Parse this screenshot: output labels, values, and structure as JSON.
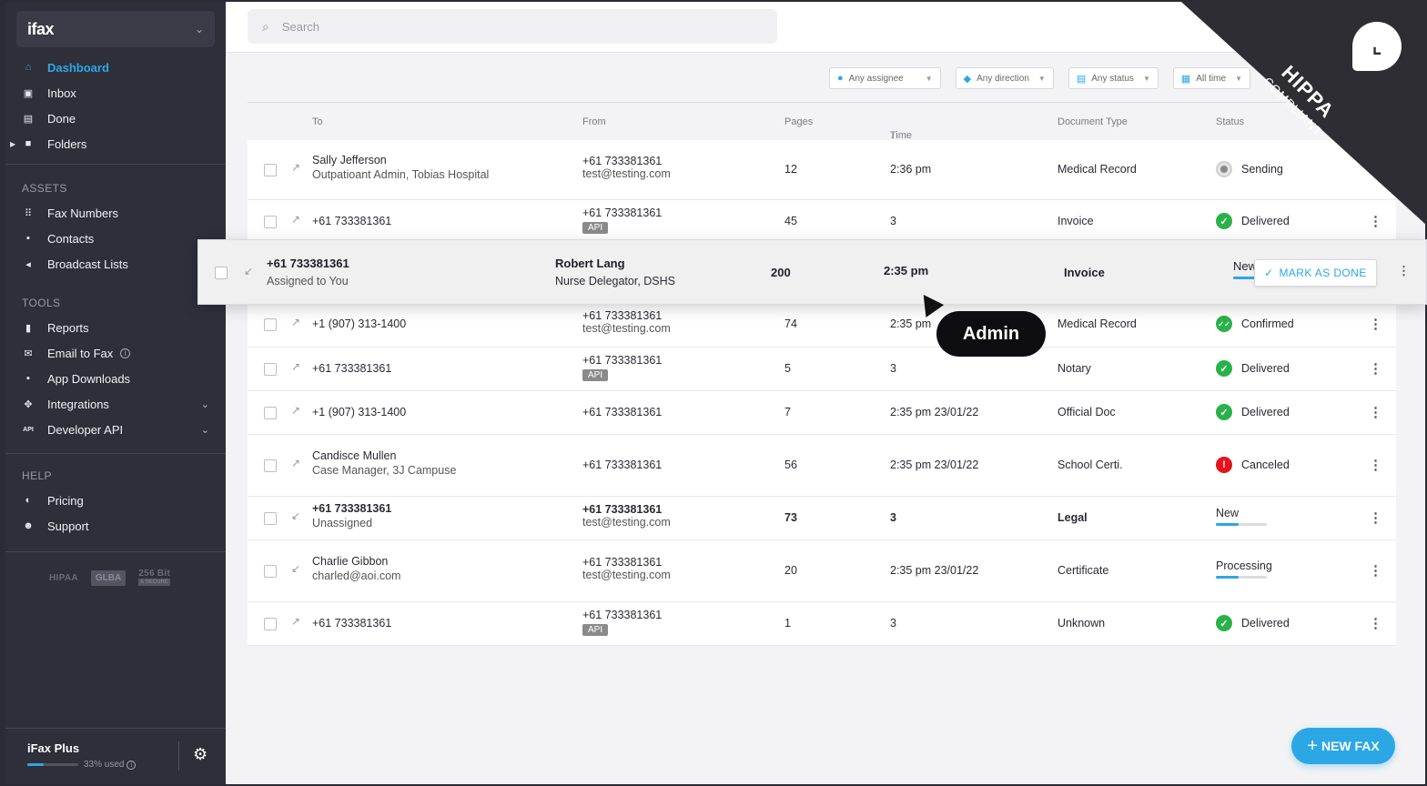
{
  "brand": {
    "logo": "ifax"
  },
  "nav": {
    "main": [
      {
        "label": "Dashboard",
        "icon": "home-icon",
        "active": true
      },
      {
        "label": "Inbox",
        "icon": "inbox-icon"
      },
      {
        "label": "Done",
        "icon": "done-icon"
      },
      {
        "label": "Folders",
        "icon": "folder-icon"
      }
    ],
    "assets_label": "ASSETS",
    "assets": [
      {
        "label": "Fax Numbers",
        "icon": "grid-icon"
      },
      {
        "label": "Contacts",
        "icon": "contact-icon"
      },
      {
        "label": "Broadcast Lists",
        "icon": "megaphone-icon"
      }
    ],
    "tools_label": "TOOLS",
    "tools": [
      {
        "label": "Reports",
        "icon": "chart-icon"
      },
      {
        "label": "Email to Fax",
        "icon": "mail-icon"
      },
      {
        "label": "App Downloads",
        "icon": "download-icon"
      },
      {
        "label": "Integrations",
        "icon": "puzzle-icon"
      },
      {
        "label": "Developer API",
        "icon": "api-icon"
      }
    ],
    "help_label": "HELP",
    "help": [
      {
        "label": "Pricing",
        "icon": "toggle-icon"
      },
      {
        "label": "Support",
        "icon": "support-icon"
      }
    ]
  },
  "compliance_badges": {
    "hipaa": "HIPAA",
    "glba": "GLBA",
    "bit": "256 Bit",
    "secure": "& SECURE"
  },
  "plan": {
    "name": "iFax Plus",
    "used": "33% used",
    "usage": 0.33
  },
  "search": {
    "placeholder": "Search"
  },
  "filters": [
    {
      "label": "Any assignee",
      "icon": "user-icon"
    },
    {
      "label": "Any direction",
      "icon": "direction-icon"
    },
    {
      "label": "Any status",
      "icon": "status-icon"
    },
    {
      "label": "All time",
      "icon": "calendar-icon"
    }
  ],
  "columns": {
    "to": "To",
    "from": "From",
    "pages": "Pages",
    "time": "Time",
    "doc_type": "Document Type",
    "status": "Status"
  },
  "rows": [
    {
      "to": "Sally Jefferson",
      "to_sub": "Outpatioant Admin, Tobias Hospital",
      "from": "+61 733381361",
      "from_sub": "test@testing.com",
      "pages": "12",
      "time": "2:36 pm",
      "doc": "Medical Record",
      "status": "Sending",
      "dir": "↗"
    },
    {
      "to": "+61 733381361",
      "to_sub": "",
      "from": "+61 733381361",
      "from_sub": "API",
      "pages": "45",
      "time": "3",
      "doc": "Invoice",
      "status": "Delivered",
      "dir": "↗"
    },
    {
      "to": "+1 (907) 313-1400",
      "to_sub": "",
      "from": "+61 733381361",
      "from_sub": "test@testing.com",
      "pages": "74",
      "time": "2:35 pm",
      "doc": "Medical Record",
      "status": "Confirmed",
      "dir": "↗"
    },
    {
      "to": "+61 733381361",
      "to_sub": "",
      "from": "+61 733381361",
      "from_sub": "API",
      "pages": "5",
      "time": "3",
      "doc": "Notary",
      "status": "Delivered",
      "dir": "↗"
    },
    {
      "to": "+1 (907) 313-1400",
      "to_sub": "",
      "from": "+61 733381361",
      "from_sub": "",
      "pages": "7",
      "time": "2:35 pm  23/01/22",
      "doc": "Official Doc",
      "status": "Delivered",
      "dir": "↗"
    },
    {
      "to": "Candisce Mullen",
      "to_sub": "Case Manager, 3J Campuse",
      "from": "+61 733381361",
      "from_sub": "",
      "pages": "56",
      "time": "2:35 pm 23/01/22",
      "doc": "School  Certi.",
      "status": "Canceled",
      "dir": "↗"
    },
    {
      "to": "+61 733381361",
      "to_sub": "Unassigned",
      "from": "+61 733381361",
      "from_sub": "test@testing.com",
      "pages": "73",
      "time": "3",
      "doc": "Legal",
      "status": "New",
      "progress": 0.45,
      "dir": "↙"
    },
    {
      "to": "Charlie Gibbon",
      "to_sub": "charled@aoi.com",
      "from": "+61 733381361",
      "from_sub": "test@testing.com",
      "pages": "20",
      "time": "2:35 pm  23/01/22",
      "doc": "Certificate",
      "status": "Processing",
      "progress": 0.45,
      "dir": "↙"
    },
    {
      "to": "+61 733381361",
      "to_sub": "",
      "from": "+61 733381361",
      "from_sub": "API",
      "pages": "1",
      "time": "3",
      "doc": "Unknown",
      "status": "Delivered",
      "dir": "↗"
    }
  ],
  "dragged_row": {
    "to": "+61 733381361",
    "to_sub": "Assigned to You",
    "from": "Robert Lang",
    "from_sub": "Nurse Delegator, DSHS",
    "pages": "200",
    "time": "2:35 pm",
    "doc": "Invoice",
    "status": "New",
    "action": "MARK AS DONE"
  },
  "tooltip": "Admin",
  "new_fax": "NEW FAX",
  "ribbon": {
    "big": "HIPPA",
    "small": "COMPLIANT"
  }
}
